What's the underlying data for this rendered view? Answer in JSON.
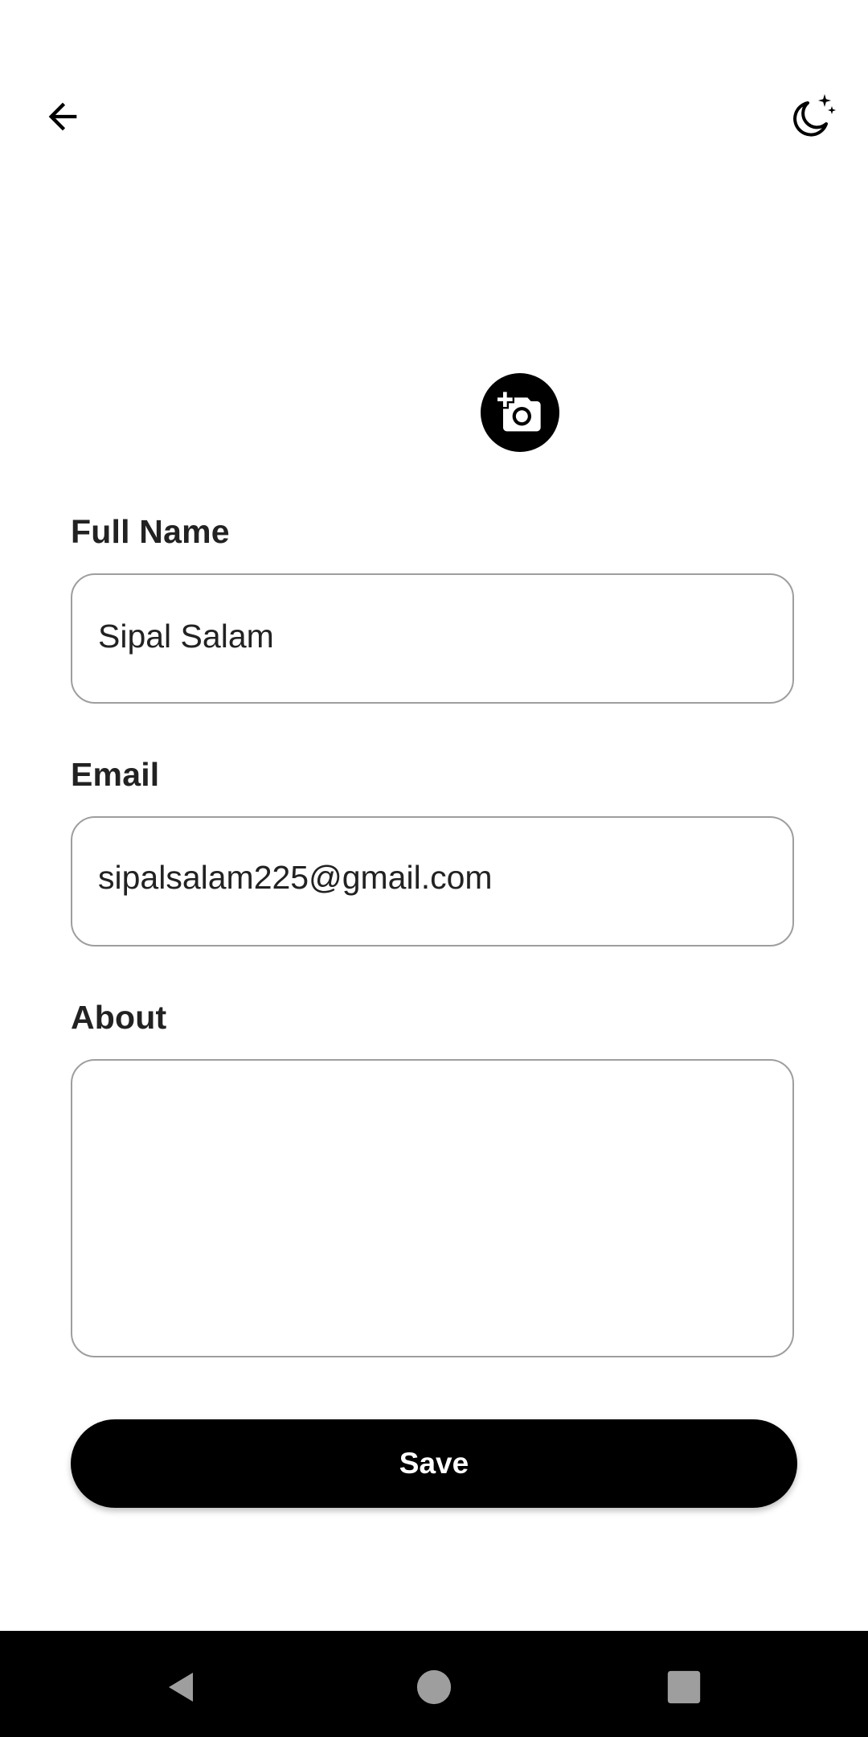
{
  "header": {
    "back_icon": "arrow-left-icon",
    "theme_icon": "moon-stars-icon"
  },
  "avatar": {
    "camera_icon": "add-photo-camera-icon"
  },
  "form": {
    "full_name": {
      "label": "Full Name",
      "value": "Sipal Salam"
    },
    "email": {
      "label": "Email",
      "value": "sipalsalam225@gmail.com"
    },
    "about": {
      "label": "About",
      "value": ""
    },
    "save_label": "Save"
  },
  "nav": {
    "back_icon": "triangle-back-icon",
    "home_icon": "circle-home-icon",
    "recents_icon": "square-recents-icon"
  },
  "colors": {
    "background": "#ffffff",
    "primary": "#000000",
    "text": "#222222",
    "border": "#9e9e9e",
    "nav_icons": "#9e9e9e"
  }
}
